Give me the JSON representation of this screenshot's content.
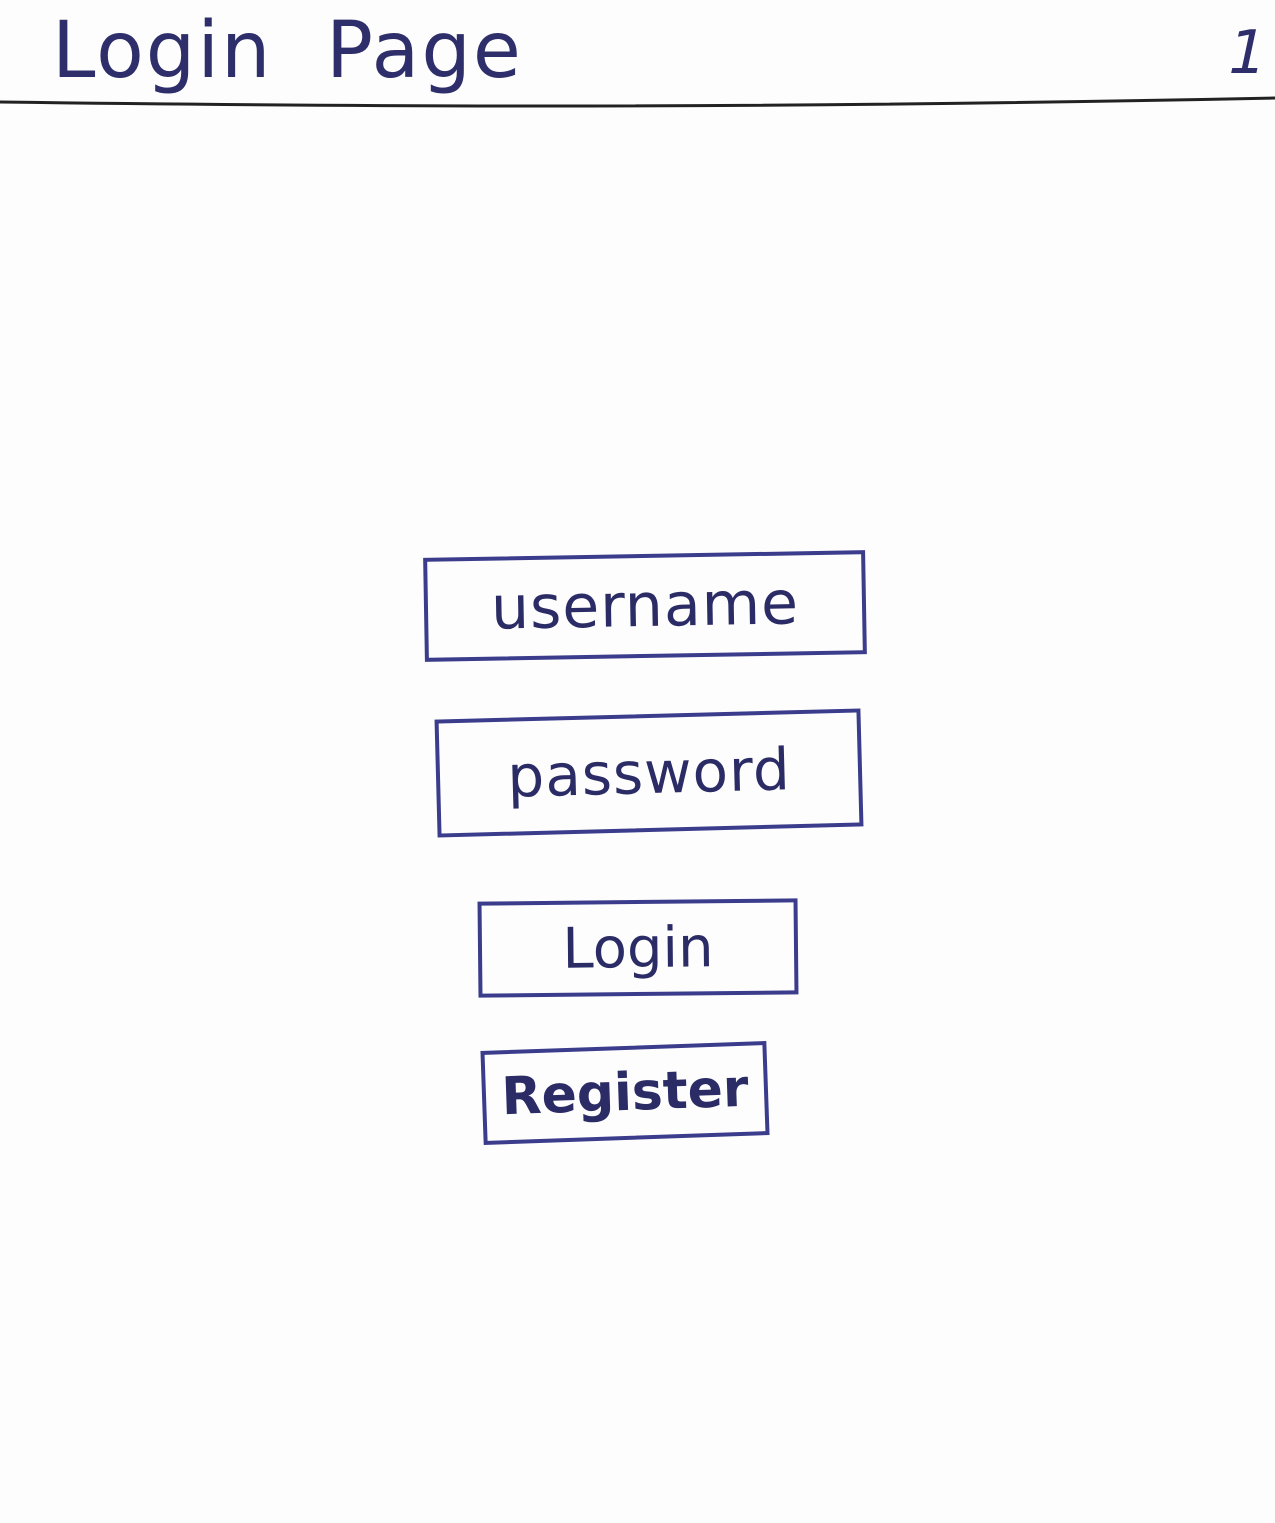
{
  "header": {
    "title": "Login  Page",
    "page_number": "1"
  },
  "form": {
    "username_placeholder": "username",
    "password_placeholder": "password",
    "login_label": "Login",
    "register_label": "Register"
  },
  "colors": {
    "ink": "#2e2f6e",
    "box_border": "#3b3c8c",
    "rule": "#222222",
    "paper": "#fdfdfd"
  }
}
